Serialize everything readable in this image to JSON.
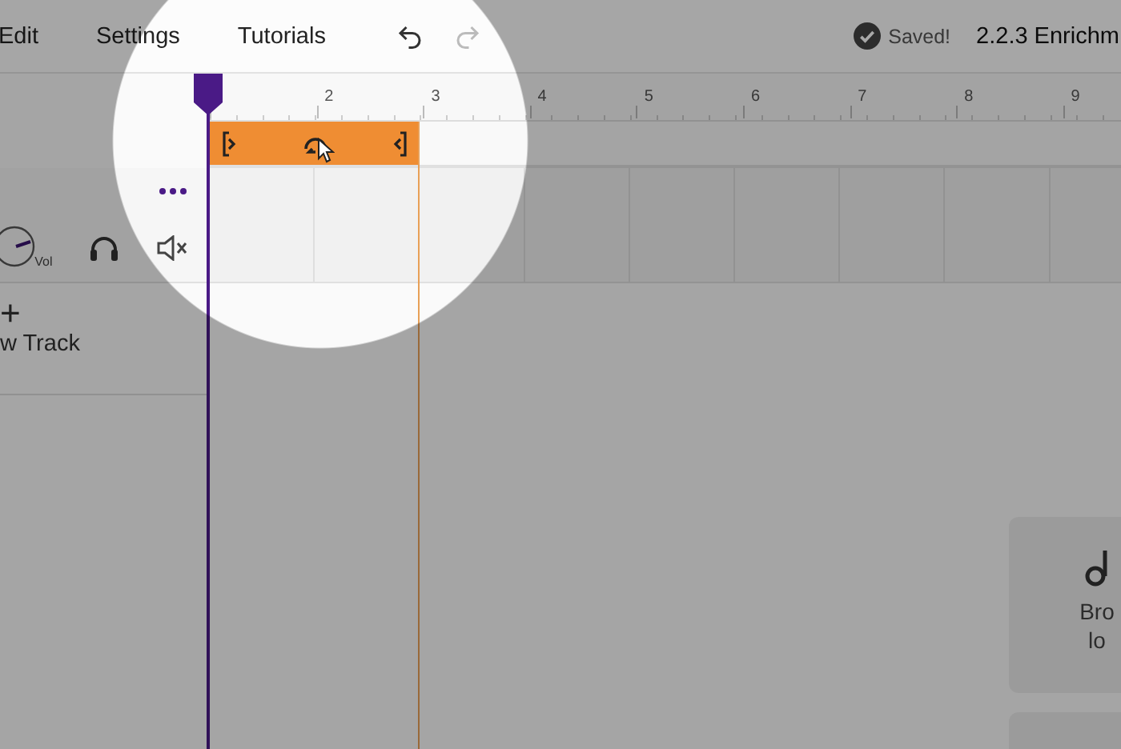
{
  "menu": [
    {
      "label": "Edit"
    },
    {
      "label": "Settings"
    },
    {
      "label": "Tutorials"
    }
  ],
  "history": {
    "undo_disabled": false,
    "redo_disabled": true
  },
  "save_status": "Saved!",
  "project_title": "2.2.3 Enrichm",
  "ruler": {
    "marks": [
      "2",
      "3",
      "4",
      "5",
      "6",
      "7",
      "8",
      "9"
    ]
  },
  "loop_region": {
    "on": true
  },
  "track": {
    "volume_label": "Vol",
    "muted": true
  },
  "add_track": {
    "icon": "+",
    "label": "w Track"
  },
  "side_card": {
    "lines": [
      "Bro",
      "lo"
    ]
  }
}
